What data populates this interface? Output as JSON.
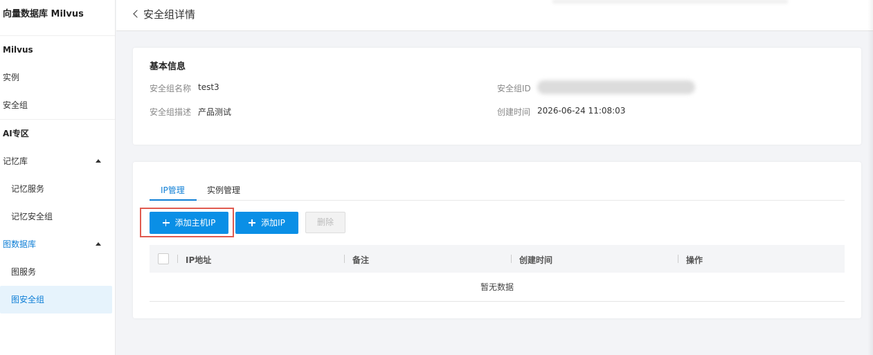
{
  "sidebar": {
    "brand": "向量数据库 Milvus",
    "section_milvus": "Milvus",
    "item_instances": "实例",
    "item_security_groups": "安全组",
    "section_ai": "AI专区",
    "memory_db": "记忆库",
    "memory_service": "记忆服务",
    "memory_security_group": "记忆安全组",
    "graph_db": "图数据库",
    "graph_service": "图服务",
    "graph_security_group": "图安全组"
  },
  "header": {
    "title": "安全组详情"
  },
  "basic_info": {
    "heading": "基本信息",
    "name_label": "安全组名称",
    "name_value": "test3",
    "desc_label": "安全组描述",
    "desc_value": "产品测试",
    "id_label": "安全组ID",
    "created_label": "创建时间",
    "created_value": "2026-06-24 11:08:03"
  },
  "ip_panel": {
    "tabs": [
      "IP管理",
      "实例管理"
    ],
    "add_host_ip": "添加主机IP",
    "add_ip": "添加IP",
    "delete": "删除",
    "columns": [
      "IP地址",
      "备注",
      "创建时间",
      "操作"
    ],
    "empty_text": "暂无数据"
  },
  "colors": {
    "accent": "#0a8fe6",
    "highlight_border": "#e05a4f"
  }
}
